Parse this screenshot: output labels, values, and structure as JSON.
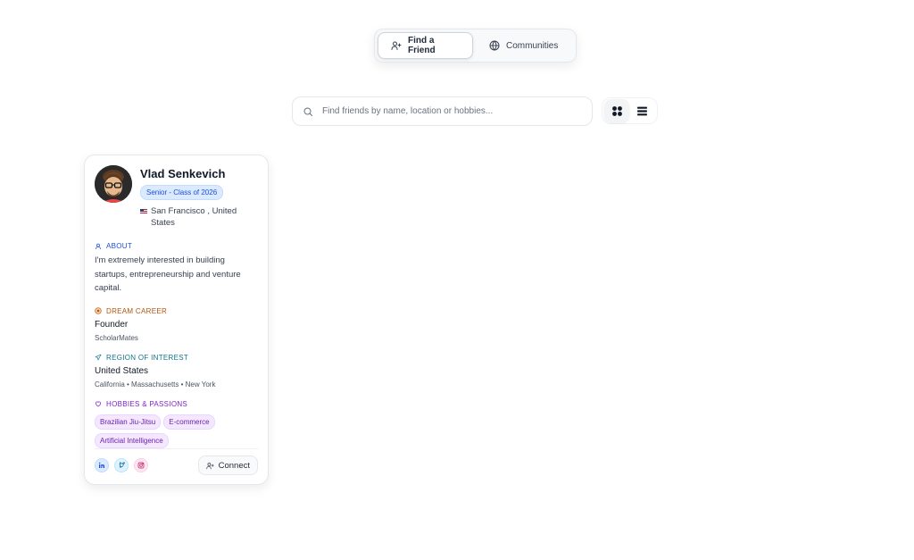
{
  "nav": {
    "tabs": [
      {
        "label": "Find a Friend",
        "icon": "user-plus-icon",
        "active": true
      },
      {
        "label": "Communities",
        "icon": "globe-icon",
        "active": false
      }
    ]
  },
  "search": {
    "placeholder": "Find friends by name, location or hobbies...",
    "value": ""
  },
  "view_toggle": {
    "options": [
      "grid-view-icon",
      "list-view-icon"
    ],
    "selected": "grid"
  },
  "card": {
    "name": "Vlad Senkevich",
    "badge": "Senior - Class of 2026",
    "location": "San Francisco , United States",
    "about_label": "ABOUT",
    "about_text": "I'm extremely interested in building startups, entrepreneurship and venture capital.",
    "career_label": "DREAM CAREER",
    "career_title": "Founder",
    "career_company": "ScholarMates",
    "region_label": "REGION OF INTEREST",
    "region_country": "United States",
    "region_states": "California • Massachusetts • New York",
    "hobbies_label": "HOBBIES & PASSIONS",
    "hobbies": [
      "Brazilian Jiu-Jitsu",
      "E-commerce",
      "Artificial Intelligence"
    ],
    "socials": [
      "linkedin-icon",
      "twitter-icon",
      "instagram-icon"
    ],
    "connect_label": "Connect"
  },
  "colors": {
    "accent_blue": "#1d4ed8",
    "career_amber": "#b45309",
    "region_teal": "#0e7490",
    "hobby_purple": "#7e22ce"
  }
}
